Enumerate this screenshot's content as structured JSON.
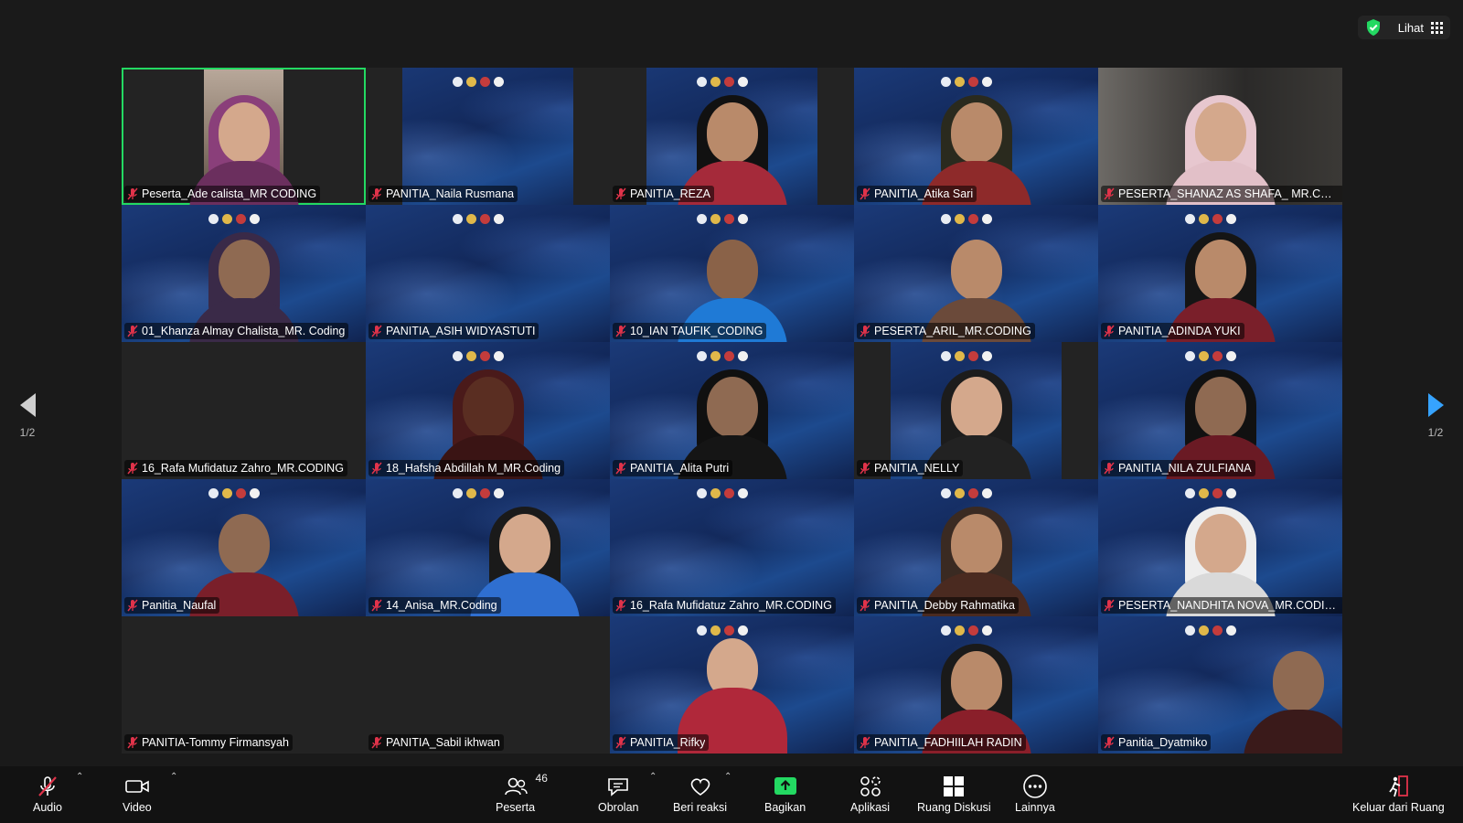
{
  "top_bar": {
    "view_label": "Lihat"
  },
  "pager": {
    "left_label": "1/2",
    "right_label": "1/2"
  },
  "tiles": [
    {
      "name": "Peserta_Ade calista_MR CODING"
    },
    {
      "name": "PANITIA_Naila Rusmana"
    },
    {
      "name": "PANITIA_REZA"
    },
    {
      "name": "PANITIA_Atika Sari"
    },
    {
      "name": "PESERTA_SHANAZ AS SHAFA_ MR.CODI..."
    },
    {
      "name": "01_Khanza Almay Chalista_MR. Coding"
    },
    {
      "name": "PANITIA_ASIH WIDYASTUTI"
    },
    {
      "name": "10_IAN TAUFIK_CODING"
    },
    {
      "name": "PESERTA_ARIL_MR.CODING"
    },
    {
      "name": "PANITIA_ADINDA YUKI"
    },
    {
      "name": "16_Rafa Mufidatuz Zahro_MR.CODING"
    },
    {
      "name": "18_Hafsha Abdillah M_MR.Coding"
    },
    {
      "name": "PANITIA_Alita Putri"
    },
    {
      "name": "PANITIA_NELLY"
    },
    {
      "name": "PANITIA_NILA ZULFIANA"
    },
    {
      "name": "Panitia_Naufal"
    },
    {
      "name": "14_Anisa_MR.Coding"
    },
    {
      "name": "16_Rafa Mufidatuz Zahro_MR.CODING"
    },
    {
      "name": "PANITIA_Debby Rahmatika"
    },
    {
      "name": "PESERTA_NANDHITA NOVA_MR.CODING"
    },
    {
      "name": "PANITIA-Tommy Firmansyah"
    },
    {
      "name": "PANITIA_Sabil ikhwan"
    },
    {
      "name": "PANITIA_Rifky"
    },
    {
      "name": "PANITIA_FADHIILAH RADIN"
    },
    {
      "name": "Panitia_Dyatmiko"
    }
  ],
  "toolbar": {
    "audio": "Audio",
    "video": "Video",
    "participants": "Peserta",
    "participants_count": "46",
    "chat": "Obrolan",
    "reactions": "Beri reaksi",
    "share": "Bagikan",
    "apps": "Aplikasi",
    "breakout": "Ruang Diskusi",
    "more": "Lainnya",
    "leave": "Keluar dari Ruang"
  },
  "colors": {
    "active_speaker": "#23d962",
    "share_green": "#23d962",
    "mic_off_red": "#e0334a",
    "pager_blue": "#36a3ff"
  }
}
